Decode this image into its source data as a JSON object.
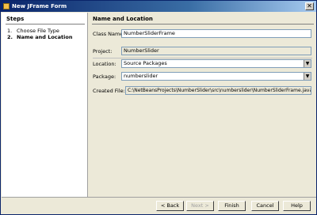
{
  "window": {
    "title": "New JFrame Form",
    "close_glyph": "✕"
  },
  "sidebar": {
    "title": "Steps",
    "steps": [
      {
        "number": "1.",
        "label": "Choose File Type"
      },
      {
        "number": "2.",
        "label": "Name and Location"
      }
    ]
  },
  "panel": {
    "title": "Name and Location",
    "class_name": {
      "label": "Class Name:",
      "value": "NumberSliderFrame"
    },
    "project": {
      "label": "Project:",
      "value": "NumberSlider"
    },
    "location": {
      "label": "Location:",
      "value": "Source Packages"
    },
    "package": {
      "label": "Package:",
      "value": "numberslider"
    },
    "created_file": {
      "label": "Created File:",
      "value": "C:\\NetBeansProjects\\NumberSlider\\src\\numberslider\\NumberSliderFrame.java"
    }
  },
  "buttons": {
    "back": "< Back",
    "next": "Next >",
    "finish": "Finish",
    "cancel": "Cancel",
    "help": "Help"
  },
  "icons": {
    "dropdown": "chevron-down-icon",
    "window": "netbeans-icon"
  }
}
